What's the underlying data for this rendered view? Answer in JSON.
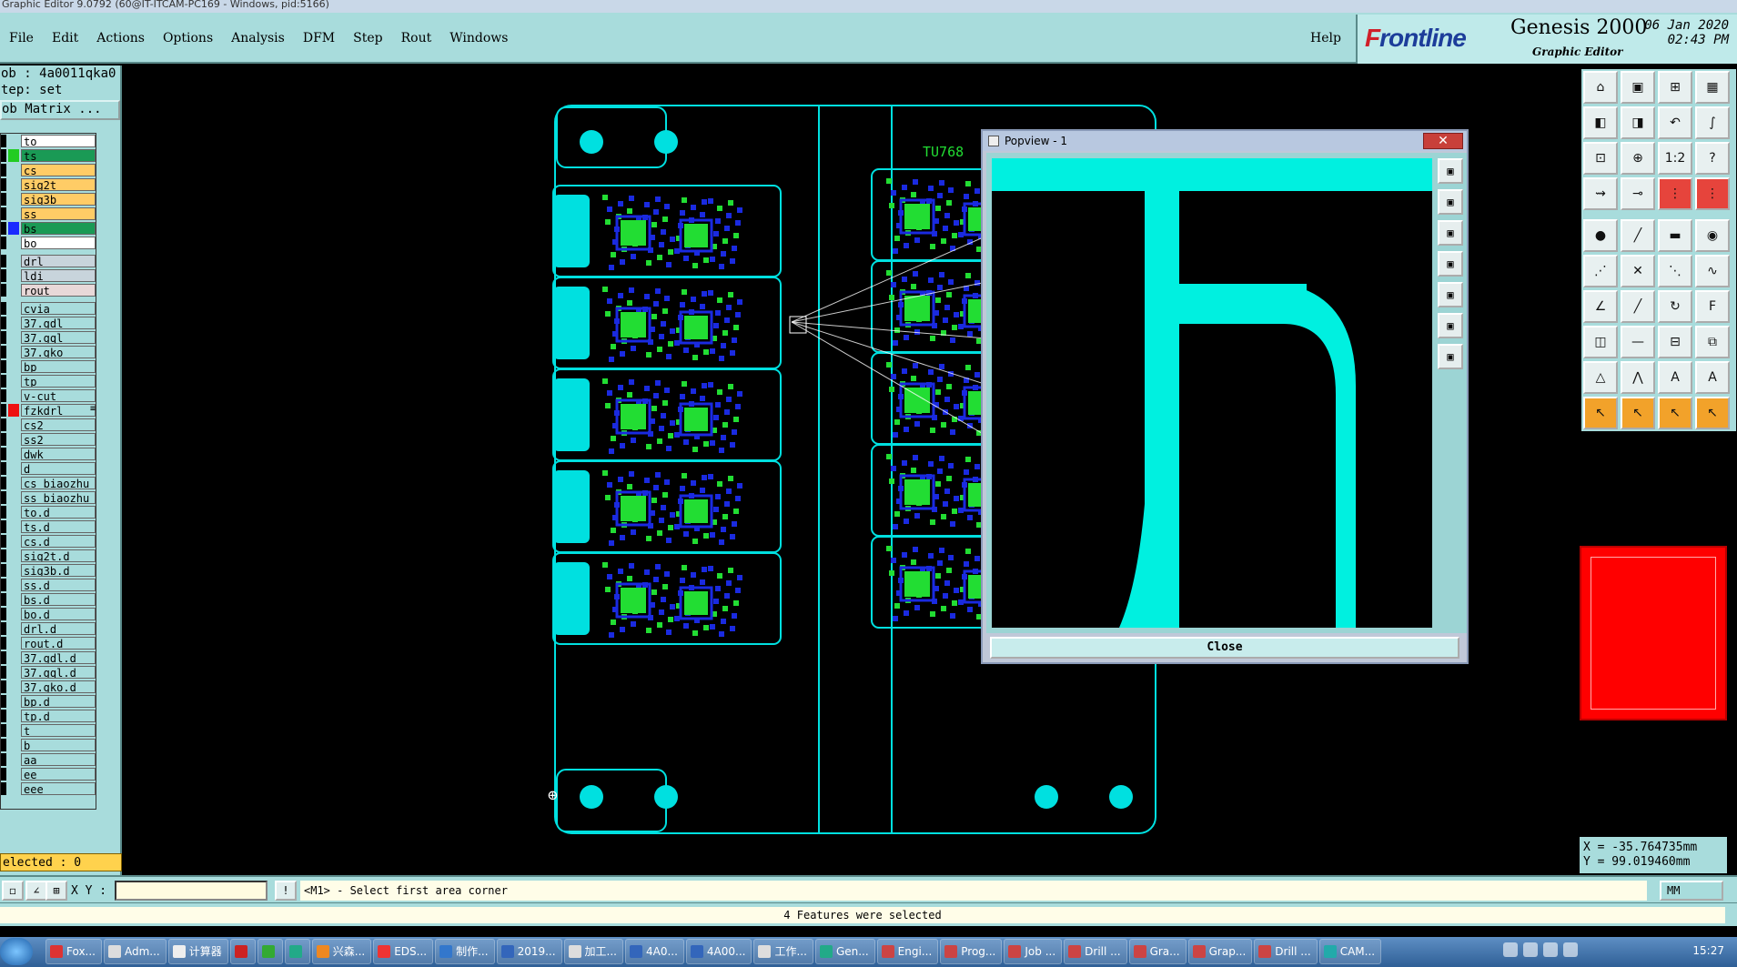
{
  "window_title": "Graphic Editor 9.0792 (60@IT-ITCAM-PC169 - Windows, pid:5166)",
  "menu": [
    "File",
    "Edit",
    "Actions",
    "Options",
    "Analysis",
    "DFM",
    "Step",
    "Rout",
    "Windows"
  ],
  "help_label": "Help",
  "logo": {
    "brand_prefix": "F",
    "brand_rest": "rontline",
    "product": "Genesis 2000",
    "subtitle": "Graphic Editor",
    "date_line1": "06 Jan 2020",
    "date_line2": "02:43 PM"
  },
  "left_panel": {
    "job": "ob : 4a0011qka0",
    "step": "tep: set",
    "job_matrix": "ob Matrix ...",
    "selected": "elected : 0"
  },
  "layers": [
    {
      "name": "to",
      "color": "#ffffff",
      "swatch": ""
    },
    {
      "name": "ts",
      "color": "#1a9a55",
      "swatch": "#22cc22"
    },
    {
      "name": "cs",
      "color": "#ffcc66",
      "swatch": ""
    },
    {
      "name": "sig2t",
      "color": "#ffcc66",
      "swatch": ""
    },
    {
      "name": "sig3b",
      "color": "#ffcc66",
      "swatch": ""
    },
    {
      "name": "ss",
      "color": "#ffcc66",
      "swatch": ""
    },
    {
      "name": "bs",
      "color": "#1a9a55",
      "swatch": "#1a2aff"
    },
    {
      "name": "bo",
      "color": "#ffffff",
      "swatch": ""
    },
    {
      "sep": true
    },
    {
      "name": "drl",
      "color": "#c8d4dc",
      "swatch": ""
    },
    {
      "name": "ldi",
      "color": "#c8d4dc",
      "swatch": ""
    },
    {
      "name": "rout",
      "color": "#e8d8d8",
      "swatch": ""
    },
    {
      "sep": true
    },
    {
      "name": "cvia",
      "color": "#a8dcdc",
      "swatch": ""
    },
    {
      "name": "37.gdl",
      "color": "#a8dcdc",
      "swatch": ""
    },
    {
      "name": "37.gql",
      "color": "#a8dcdc",
      "swatch": ""
    },
    {
      "name": "37.gko",
      "color": "#a8dcdc",
      "swatch": ""
    },
    {
      "name": "bp",
      "color": "#a8dcdc",
      "swatch": ""
    },
    {
      "name": "tp",
      "color": "#a8dcdc",
      "swatch": ""
    },
    {
      "name": "v-cut",
      "color": "#a8dcdc",
      "swatch": ""
    },
    {
      "name": "fzkdrl",
      "color": "#a8dcdc",
      "swatch": "#ee1111",
      "mark": "≡"
    },
    {
      "name": "cs2",
      "color": "#a8dcdc",
      "swatch": ""
    },
    {
      "name": "ss2",
      "color": "#a8dcdc",
      "swatch": ""
    },
    {
      "name": "dwk",
      "color": "#a8dcdc",
      "swatch": ""
    },
    {
      "name": "d",
      "color": "#a8dcdc",
      "swatch": ""
    },
    {
      "name": "cs_biaozhu",
      "color": "#a8dcdc",
      "swatch": ""
    },
    {
      "name": "ss_biaozhu",
      "color": "#a8dcdc",
      "swatch": ""
    },
    {
      "name": "to.d",
      "color": "#a8dcdc",
      "swatch": ""
    },
    {
      "name": "ts.d",
      "color": "#a8dcdc",
      "swatch": ""
    },
    {
      "name": "cs.d",
      "color": "#a8dcdc",
      "swatch": ""
    },
    {
      "name": "sig2t.d",
      "color": "#a8dcdc",
      "swatch": ""
    },
    {
      "name": "sig3b.d",
      "color": "#a8dcdc",
      "swatch": ""
    },
    {
      "name": "ss.d",
      "color": "#a8dcdc",
      "swatch": ""
    },
    {
      "name": "bs.d",
      "color": "#a8dcdc",
      "swatch": ""
    },
    {
      "name": "bo.d",
      "color": "#a8dcdc",
      "swatch": ""
    },
    {
      "name": "drl.d",
      "color": "#a8dcdc",
      "swatch": ""
    },
    {
      "name": "rout.d",
      "color": "#a8dcdc",
      "swatch": ""
    },
    {
      "name": "37.gdl.d",
      "color": "#a8dcdc",
      "swatch": ""
    },
    {
      "name": "37.gql.d",
      "color": "#a8dcdc",
      "swatch": ""
    },
    {
      "name": "37.gko.d",
      "color": "#a8dcdc",
      "swatch": ""
    },
    {
      "name": "bp.d",
      "color": "#a8dcdc",
      "swatch": ""
    },
    {
      "name": "tp.d",
      "color": "#a8dcdc",
      "swatch": ""
    },
    {
      "name": "t",
      "color": "#a8dcdc",
      "swatch": ""
    },
    {
      "name": "b",
      "color": "#a8dcdc",
      "swatch": ""
    },
    {
      "name": "aa",
      "color": "#a8dcdc",
      "swatch": ""
    },
    {
      "name": "ee",
      "color": "#a8dcdc",
      "swatch": ""
    },
    {
      "name": "eee",
      "color": "#a8dcdc",
      "swatch": ""
    }
  ],
  "canvas": {
    "board_label": "TU768",
    "outline_color": "#00e0e0",
    "green": "#22dd33",
    "blue": "#1a2ae0"
  },
  "popview": {
    "title": "Popview - 1",
    "close_label": "Close",
    "close_x": "✕"
  },
  "tools": [
    {
      "icon": "home-icon",
      "glyph": "⌂"
    },
    {
      "icon": "save-icon",
      "glyph": "▣"
    },
    {
      "icon": "layout-icon",
      "glyph": "⊞"
    },
    {
      "icon": "panel-icon",
      "glyph": "▦"
    },
    {
      "icon": "left-icon",
      "glyph": "◧"
    },
    {
      "icon": "right-icon",
      "glyph": "◨"
    },
    {
      "icon": "undo-icon",
      "glyph": "↶"
    },
    {
      "icon": "s-curve-icon",
      "glyph": "∫"
    },
    {
      "icon": "fit-icon",
      "glyph": "⊡"
    },
    {
      "icon": "zoom-icon",
      "glyph": "⊕"
    },
    {
      "icon": "scale-icon",
      "glyph": "1:2"
    },
    {
      "icon": "question-icon",
      "glyph": "?"
    },
    {
      "icon": "measure-icon",
      "glyph": "⇝"
    },
    {
      "icon": "key-icon",
      "glyph": "⊸"
    },
    {
      "icon": "layers-icon",
      "glyph": "⋮",
      "style": "red"
    },
    {
      "icon": "layers2-icon",
      "glyph": "⋮",
      "style": "red"
    },
    {
      "icon": "pad-icon",
      "glyph": "●"
    },
    {
      "icon": "line-icon",
      "glyph": "╱"
    },
    {
      "icon": "ruler-icon",
      "glyph": "▬"
    },
    {
      "icon": "circle-icon",
      "glyph": "◉"
    },
    {
      "icon": "connect-icon",
      "glyph": "⋰"
    },
    {
      "icon": "cross-icon",
      "glyph": "✕"
    },
    {
      "icon": "link-icon",
      "glyph": "⋱"
    },
    {
      "icon": "wave-icon",
      "glyph": "∿"
    },
    {
      "icon": "angle-icon",
      "glyph": "∠"
    },
    {
      "icon": "slash-icon",
      "glyph": "╱"
    },
    {
      "icon": "arc-icon",
      "glyph": "↻"
    },
    {
      "icon": "text-icon",
      "glyph": "F"
    },
    {
      "icon": "node-icon",
      "glyph": "◫"
    },
    {
      "icon": "minus-icon",
      "glyph": "—"
    },
    {
      "icon": "align-icon",
      "glyph": "⊟"
    },
    {
      "icon": "group-icon",
      "glyph": "⧉"
    },
    {
      "icon": "triangle-icon",
      "glyph": "△"
    },
    {
      "icon": "mountain-icon",
      "glyph": "⋀"
    },
    {
      "icon": "a-icon",
      "glyph": "A"
    },
    {
      "icon": "a2-icon",
      "glyph": "A"
    },
    {
      "icon": "pointer-icon",
      "glyph": "↖",
      "style": "orange"
    },
    {
      "icon": "pointer2-icon",
      "glyph": "↖",
      "style": "orange"
    },
    {
      "icon": "pointer3-icon",
      "glyph": "↖",
      "style": "orange"
    },
    {
      "icon": "pointer4-icon",
      "glyph": "↖",
      "style": "orange"
    }
  ],
  "coords": {
    "x": "X = -35.764735mm",
    "y": "Y =  99.019460mm"
  },
  "cmd": {
    "xy_label": "X Y :",
    "xy_value": "",
    "prompt": "<M1> - Select first area corner",
    "units": "MM",
    "status": "4 Features were selected"
  },
  "taskbar": {
    "items": [
      {
        "label": "Fox...",
        "color": "#d33"
      },
      {
        "label": "Adm...",
        "color": "#ddd"
      },
      {
        "label": "计算器",
        "color": "#eee"
      },
      {
        "label": "",
        "color": "#c22"
      },
      {
        "label": "",
        "color": "#3a3"
      },
      {
        "label": "",
        "color": "#2a8"
      },
      {
        "label": "兴森...",
        "color": "#e82"
      },
      {
        "label": "EDS...",
        "color": "#e33"
      },
      {
        "label": "制作...",
        "color": "#37c"
      },
      {
        "label": "2019...",
        "color": "#36b"
      },
      {
        "label": "加工...",
        "color": "#ddd"
      },
      {
        "label": "4A0...",
        "color": "#36b"
      },
      {
        "label": "4A00...",
        "color": "#36b"
      },
      {
        "label": "工作...",
        "color": "#ddd"
      },
      {
        "label": "Gen...",
        "color": "#2a8"
      },
      {
        "label": "Engi...",
        "color": "#c44"
      },
      {
        "label": "Prog...",
        "color": "#c44"
      },
      {
        "label": "Job ...",
        "color": "#c44"
      },
      {
        "label": "Drill ...",
        "color": "#c44"
      },
      {
        "label": "Gra...",
        "color": "#c44"
      },
      {
        "label": "Grap...",
        "color": "#c44"
      },
      {
        "label": "Drill ...",
        "color": "#c44"
      },
      {
        "label": "CAM...",
        "color": "#2aa"
      }
    ],
    "clock": "15:27"
  }
}
